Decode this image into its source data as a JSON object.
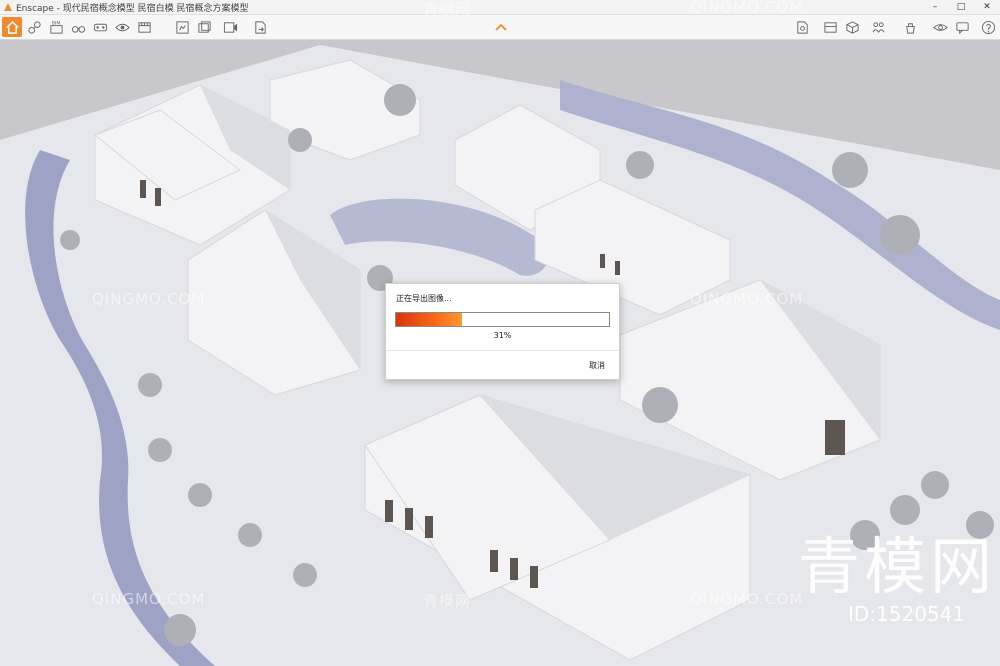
{
  "window": {
    "title": "Enscape - 现代民宿概念模型 民宿白模 民宿概念方案模型",
    "minimize": "–",
    "maximize": "□",
    "close": "✕"
  },
  "toolbar": {
    "left_icons": [
      "home-icon",
      "link-icon",
      "bim-icon",
      "binoculars-icon",
      "vr-icon",
      "eye-icon",
      "film-icon",
      "asset-library-icon",
      "batch-render-icon",
      "export-video-icon",
      "export-file-icon"
    ],
    "bim_label": "BIM",
    "right_icons": [
      "settings-file-icon",
      "cube-icon",
      "people-icon",
      "asset-icon",
      "visual-settings-icon",
      "feedback-icon",
      "help-icon"
    ],
    "accent_color": "#f08a2c"
  },
  "dialog": {
    "title": "正在导出图像...",
    "progress_percent": 31,
    "progress_label": "31%",
    "cancel_label": "取消"
  },
  "watermarks": {
    "cn": "青模网",
    "en": "QINGMO.COM",
    "big": "青模网",
    "id": "ID:1520541"
  }
}
